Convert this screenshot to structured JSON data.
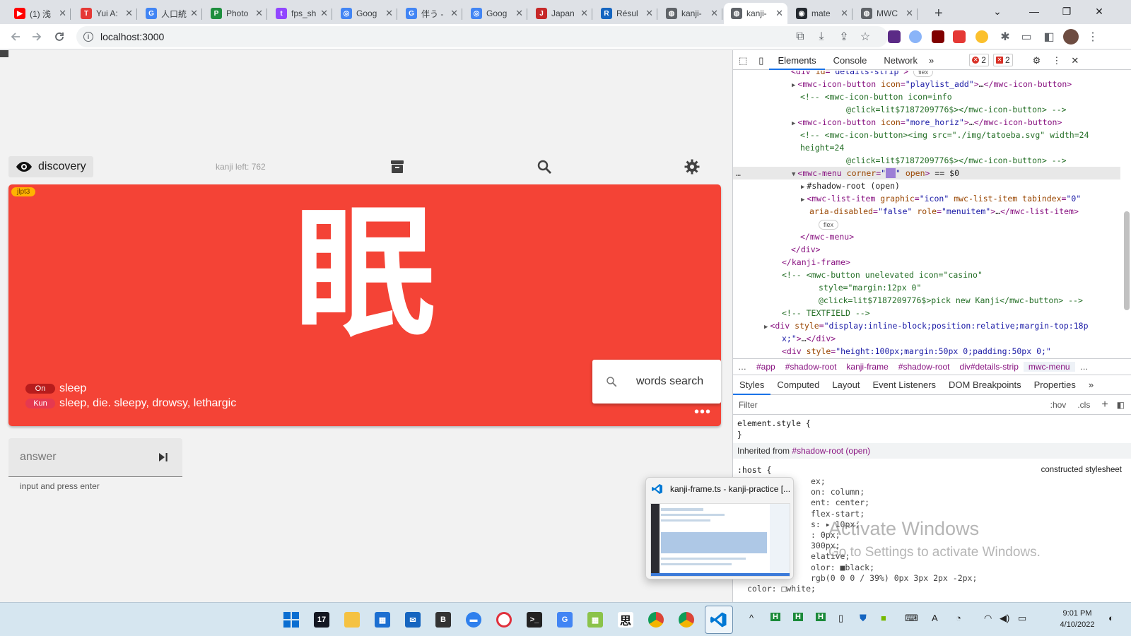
{
  "browser": {
    "tabs": [
      {
        "title": "(1) 浅",
        "color": "#ff0000",
        "glyph": "▶"
      },
      {
        "title": "Yui A:",
        "color": "#e53935",
        "glyph": "T"
      },
      {
        "title": "人口統",
        "color": "#4285f4",
        "glyph": "G"
      },
      {
        "title": "Photo",
        "color": "#1e8e3e",
        "glyph": "P"
      },
      {
        "title": "fps_sh",
        "color": "#9146ff",
        "glyph": "t"
      },
      {
        "title": "Goog",
        "color": "#4285f4",
        "glyph": "◎"
      },
      {
        "title": "伴う -",
        "color": "#4285f4",
        "glyph": "G"
      },
      {
        "title": "Goog",
        "color": "#4285f4",
        "glyph": "◎"
      },
      {
        "title": "Japan",
        "color": "#c62828",
        "glyph": "J"
      },
      {
        "title": "Résul",
        "color": "#1565c0",
        "glyph": "R"
      },
      {
        "title": "kanji-",
        "color": "#5f6368",
        "glyph": "◍"
      },
      {
        "title": "kanji-",
        "color": "#5f6368",
        "glyph": "◍",
        "active": true
      },
      {
        "title": "mate",
        "color": "#24292f",
        "glyph": "◉"
      },
      {
        "title": "MWC",
        "color": "#5f6368",
        "glyph": "◍"
      }
    ],
    "new_tab": "+",
    "url": "localhost:3000"
  },
  "app": {
    "mode_label": "discovery",
    "kanji_left": "kanji left: 762",
    "jlpt": "jlpt3",
    "kanji": "眠",
    "on_tag": "On",
    "on_reading": "sleep",
    "kun_tag": "Kun",
    "kun_reading": "sleep, die. sleepy, drowsy, lethargic",
    "words_search": "words search",
    "answer_placeholder": "answer",
    "answer_helper": "input and press enter",
    "colors": {
      "frame": "#f44336",
      "badge": "#ffb300"
    }
  },
  "devtools": {
    "tabs": [
      "Elements",
      "Console",
      "Network"
    ],
    "more": "»",
    "errors": "2",
    "warnings": "2",
    "tree": [
      {
        "indent": 6,
        "html": "<span class='t'>&lt;div</span> <span class='an'>id</span>=<span class='av'>\"details-strip\"</span><span class='t'>&gt;</span> <span class='flexchip'>flex</span>"
      },
      {
        "indent": 7,
        "arrow": "▶",
        "html": "<span class='t'>&lt;mwc-icon-button</span> <span class='an'>icon</span>=<span class='av'>\"playlist_add\"</span><span class='t'>&gt;</span><span class='pl'>…</span><span class='t'>&lt;/mwc-icon-button&gt;</span>"
      },
      {
        "indent": 7,
        "html": "<span class='cm'>&lt;!-- &lt;mwc-icon-button icon=info</span>"
      },
      {
        "indent": 12,
        "html": "<span class='cm'>@click=lit$7187209776$&gt;&lt;/mwc-icon-button&gt; --&gt;</span>"
      },
      {
        "indent": 7,
        "arrow": "▶",
        "html": "<span class='t'>&lt;mwc-icon-button</span> <span class='an'>icon</span>=<span class='av'>\"more_horiz\"</span><span class='t'>&gt;</span><span class='pl'>…</span><span class='t'>&lt;/mwc-icon-button&gt;</span>"
      },
      {
        "indent": 7,
        "html": "<span class='cm'>&lt;!-- &lt;mwc-icon-button&gt;&lt;img src=\"./img/tatoeba.svg\" width=24</span>"
      },
      {
        "indent": 7,
        "html": "<span class='cm'>height=24</span>"
      },
      {
        "indent": 12,
        "html": "<span class='cm'>@click=lit$7187209776$&gt;&lt;/mwc-icon-button&gt; --&gt;</span>"
      },
      {
        "indent": 7,
        "arrow": "▼",
        "sel": true,
        "html": "<span class='t'>&lt;mwc-menu</span> <span class='an'>corner</span>=<span class='av'>\"<span style='background:#9c7fd6;color:#9c7fd6'>██</span>\"</span> <span class='an'>open</span><span class='t'>&gt;</span> <span class='pl'>== $0</span>"
      },
      {
        "indent": 8,
        "arrow": "▶",
        "html": "<span class='pl'>#shadow-root (open)</span>"
      },
      {
        "indent": 8,
        "arrow": "▶",
        "html": "<span class='t'>&lt;mwc-list-item</span> <span class='an'>graphic</span>=<span class='av'>\"icon\"</span> <span class='an'>mwc-list-item</span> <span class='an'>tabindex</span>=<span class='av'>\"0\"</span>"
      },
      {
        "indent": 8,
        "html": "<span class='an'>aria-disabled</span>=<span class='av'>\"false\"</span> <span class='an'>role</span>=<span class='av'>\"menuitem\"</span><span class='t'>&gt;</span><span class='pl'>…</span><span class='t'>&lt;/mwc-list-item&gt;</span>"
      },
      {
        "indent": 9,
        "html": "<span class='flexchip'>flex</span>"
      },
      {
        "indent": 7,
        "html": "<span class='t'>&lt;/mwc-menu&gt;</span>"
      },
      {
        "indent": 6,
        "html": "<span class='t'>&lt;/div&gt;</span>"
      },
      {
        "indent": 5,
        "html": "<span class='t'>&lt;/kanji-frame&gt;</span>"
      },
      {
        "indent": 5,
        "html": "<span class='cm'>&lt;!-- &lt;mwc-button unelevated icon=\"casino\"</span>"
      },
      {
        "indent": 9,
        "html": "<span class='cm'>style=\"margin:12px 0\"</span>"
      },
      {
        "indent": 9,
        "html": "<span class='cm'>@click=lit$7187209776$&gt;pick new Kanji&lt;/mwc-button&gt; --&gt;</span>"
      },
      {
        "indent": 5,
        "html": "<span class='cm'>&lt;!-- TEXTFIELD --&gt;</span>"
      },
      {
        "indent": 4,
        "arrow": "▶",
        "html": "<span class='t'>&lt;div</span> <span class='an'>style</span>=<span class='av'>\"display:inline-block;position:relative;margin-top:18p</span>"
      },
      {
        "indent": 5,
        "html": "<span class='av'>x;\"</span><span class='t'>&gt;</span><span class='pl'>…</span><span class='t'>&lt;/div&gt;</span>"
      },
      {
        "indent": 5,
        "html": "<span class='t'>&lt;div</span> <span class='an'>style</span>=<span class='av'>\"height:100px;margin:50px 0;padding:50px 0;\"</span>"
      }
    ],
    "breadcrumbs": [
      "…",
      "#app",
      "#shadow-root",
      "kanji-frame",
      "#shadow-root",
      "div#details-strip",
      "mwc-menu",
      "…"
    ],
    "style_tabs": [
      "Styles",
      "Computed",
      "Layout",
      "Event Listeners",
      "DOM Breakpoints",
      "Properties",
      "»"
    ],
    "filter_placeholder": "Filter",
    "hov": ":hov",
    "cls": ".cls",
    "element_style": "element.style {",
    "close_brace": "}",
    "inherited_label": "Inherited from",
    "inherited_from": "#shadow-root (open)",
    "host_selector": ":host {",
    "constructed": "constructed stylesheet",
    "style_lines": [
      "ex;",
      "on: column;",
      "ent: center;",
      "  flex-start;",
      "s: ▸ 10px;",
      ": 0px;",
      "300px;",
      "elative;",
      "olor: ■black;",
      "  rgb(0 0 0 / 39%) 0px 3px 2px -2px;",
      "color: □white;"
    ]
  },
  "watermark": {
    "line1": "Activate Windows",
    "line2": "Go to Settings to activate Windows."
  },
  "preview": {
    "title": "kanji-frame.ts - kanji-practice [..."
  },
  "taskbar": {
    "time": "9:01 PM",
    "date": "4/10/2022"
  }
}
